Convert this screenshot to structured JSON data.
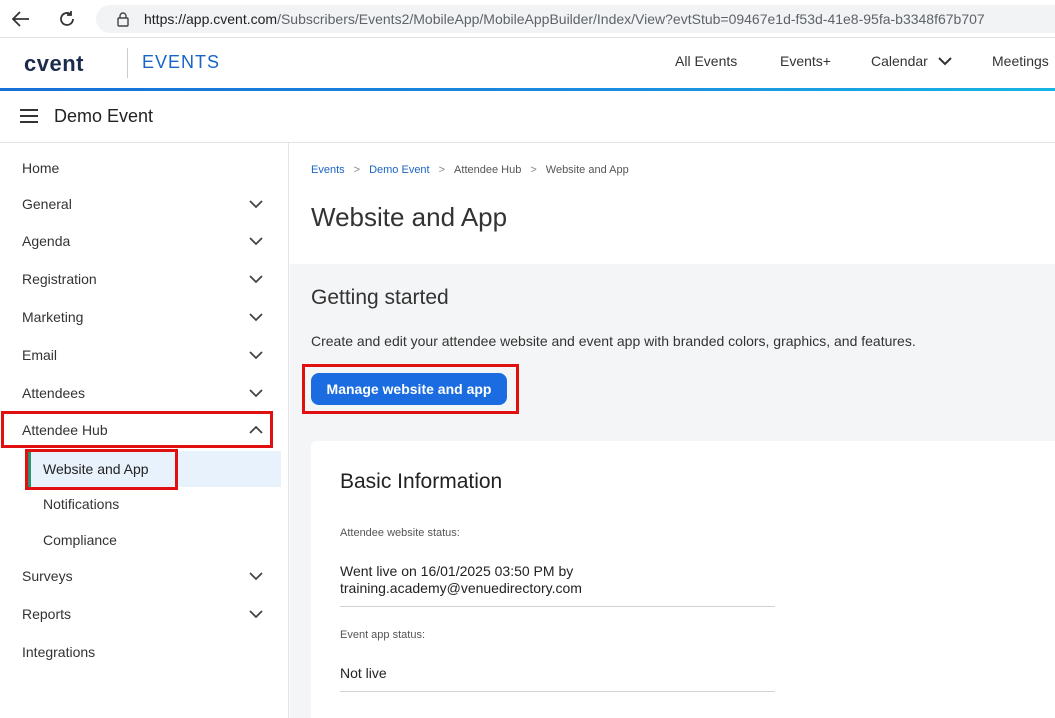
{
  "browser": {
    "url_host": "https://app.cvent.com",
    "url_path": "/Subscribers/Events2/MobileApp/MobileAppBuilder/Index/View?evtStub=09467e1d-f53d-41e8-95fa-b3348f67b707"
  },
  "header": {
    "logo": "cvent",
    "product": "EVENTS",
    "nav": [
      "All Events",
      "Events+",
      "Calendar",
      "Meetings"
    ]
  },
  "event": {
    "title": "Demo Event"
  },
  "sidebar": {
    "items": [
      {
        "label": "Home"
      },
      {
        "label": "General"
      },
      {
        "label": "Agenda"
      },
      {
        "label": "Registration"
      },
      {
        "label": "Marketing"
      },
      {
        "label": "Email"
      },
      {
        "label": "Attendees"
      },
      {
        "label": "Attendee Hub"
      },
      {
        "label": "Website and App"
      },
      {
        "label": "Notifications"
      },
      {
        "label": "Compliance"
      },
      {
        "label": "Surveys"
      },
      {
        "label": "Reports"
      },
      {
        "label": "Integrations"
      }
    ]
  },
  "breadcrumb": [
    "Events",
    "Demo Event",
    "Attendee Hub",
    "Website and App"
  ],
  "page": {
    "title": "Website and App"
  },
  "getting_started": {
    "title": "Getting started",
    "description": "Create and edit your attendee website and event app with branded colors, graphics, and features.",
    "button": "Manage website and app"
  },
  "basic_info": {
    "title": "Basic Information",
    "website_status_label": "Attendee website status:",
    "website_status_line1": "Went live on 16/01/2025 03:50 PM by",
    "website_status_line2": "training.academy@venuedirectory.com",
    "app_status_label": "Event app status:",
    "app_status_value": "Not live"
  },
  "colors": {
    "accent": "#1a6ce0",
    "link": "#1a64c7",
    "highlight": "#e01010",
    "active_bar": "#2f8f6f"
  }
}
